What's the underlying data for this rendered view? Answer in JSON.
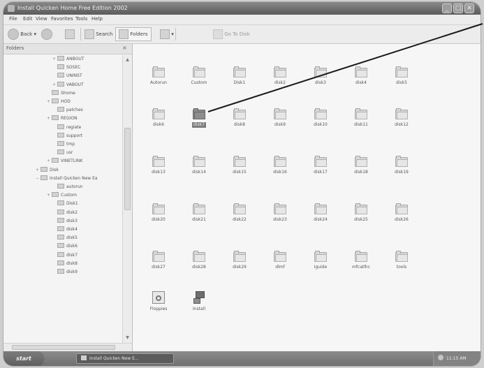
{
  "window": {
    "title": "Install Quicken Home Free Edition 2002",
    "buttons": {
      "minimize": "_",
      "maximize": "□",
      "close": "✕"
    }
  },
  "menu": [
    "File",
    "Edit",
    "View",
    "Favorites",
    "Tools",
    "Help"
  ],
  "toolbar": {
    "back": "Back",
    "search": "Search",
    "folders": "Folders",
    "go": "Go To Disk"
  },
  "left_pane": {
    "header": "Folders",
    "close": "×",
    "tree": [
      {
        "label": "ANBOUT",
        "expander": "+"
      },
      {
        "label": "SOSEC",
        "expander": ""
      },
      {
        "label": "UNINST",
        "expander": ""
      },
      {
        "label": "VABOUT",
        "expander": "+"
      },
      {
        "label": "Shome",
        "expander": ""
      },
      {
        "label": "HOD",
        "expander": "+"
      },
      {
        "label": "patches",
        "expander": ""
      },
      {
        "label": "REGION",
        "expander": "+"
      },
      {
        "label": "regiate",
        "expander": ""
      },
      {
        "label": "support",
        "expander": ""
      },
      {
        "label": "tmp",
        "expander": ""
      },
      {
        "label": "usr",
        "expander": ""
      },
      {
        "label": "VINETLINK",
        "expander": "+"
      },
      {
        "label": "Disk",
        "expander": "+"
      },
      {
        "label": "Install Quicken New Ea",
        "expander": "−"
      },
      {
        "label": "autorun",
        "expander": ""
      },
      {
        "label": "Custom",
        "expander": "+"
      },
      {
        "label": "Disk1",
        "expander": ""
      },
      {
        "label": "disk2",
        "expander": ""
      },
      {
        "label": "disk3",
        "expander": ""
      },
      {
        "label": "disk4",
        "expander": ""
      },
      {
        "label": "disk5",
        "expander": ""
      },
      {
        "label": "disk6",
        "expander": ""
      },
      {
        "label": "disk7",
        "expander": ""
      },
      {
        "label": "disk8",
        "expander": ""
      },
      {
        "label": "disk9",
        "expander": ""
      }
    ]
  },
  "items": [
    {
      "label": "Autorun",
      "type": "folder"
    },
    {
      "label": "Custom",
      "type": "folder"
    },
    {
      "label": "Disk1",
      "type": "folder"
    },
    {
      "label": "disk2",
      "type": "folder"
    },
    {
      "label": "disk3",
      "type": "folder"
    },
    {
      "label": "disk4",
      "type": "folder"
    },
    {
      "label": "disk5",
      "type": "folder"
    },
    {
      "label": "disk6",
      "type": "folder"
    },
    {
      "label": "disk7",
      "type": "folder",
      "selected": true
    },
    {
      "label": "disk8",
      "type": "folder"
    },
    {
      "label": "disk9",
      "type": "folder"
    },
    {
      "label": "disk10",
      "type": "folder"
    },
    {
      "label": "disk11",
      "type": "folder"
    },
    {
      "label": "disk12",
      "type": "folder"
    },
    {
      "label": "disk13",
      "type": "folder"
    },
    {
      "label": "disk14",
      "type": "folder"
    },
    {
      "label": "disk15",
      "type": "folder"
    },
    {
      "label": "disk16",
      "type": "folder"
    },
    {
      "label": "disk17",
      "type": "folder"
    },
    {
      "label": "disk18",
      "type": "folder"
    },
    {
      "label": "disk19",
      "type": "folder"
    },
    {
      "label": "disk20",
      "type": "folder"
    },
    {
      "label": "disk21",
      "type": "folder"
    },
    {
      "label": "disk22",
      "type": "folder"
    },
    {
      "label": "disk23",
      "type": "folder"
    },
    {
      "label": "disk24",
      "type": "folder"
    },
    {
      "label": "disk25",
      "type": "folder"
    },
    {
      "label": "disk26",
      "type": "folder"
    },
    {
      "label": "disk27",
      "type": "folder"
    },
    {
      "label": "disk28",
      "type": "folder"
    },
    {
      "label": "disk29",
      "type": "folder"
    },
    {
      "label": "dlmf",
      "type": "folder"
    },
    {
      "label": "Iguide",
      "type": "folder"
    },
    {
      "label": "mfcatlhc",
      "type": "folder"
    },
    {
      "label": "tools",
      "type": "folder"
    },
    {
      "label": "Floppies",
      "type": "floppies"
    },
    {
      "label": "Install",
      "type": "install"
    }
  ],
  "taskbar": {
    "start": "start",
    "task": "Install Quicken New E...",
    "clock": "11:15 AM"
  },
  "colors": {
    "title_bar": "#6c6c6c",
    "selection": "#7d7d7d",
    "background": "#f6f6f6"
  }
}
